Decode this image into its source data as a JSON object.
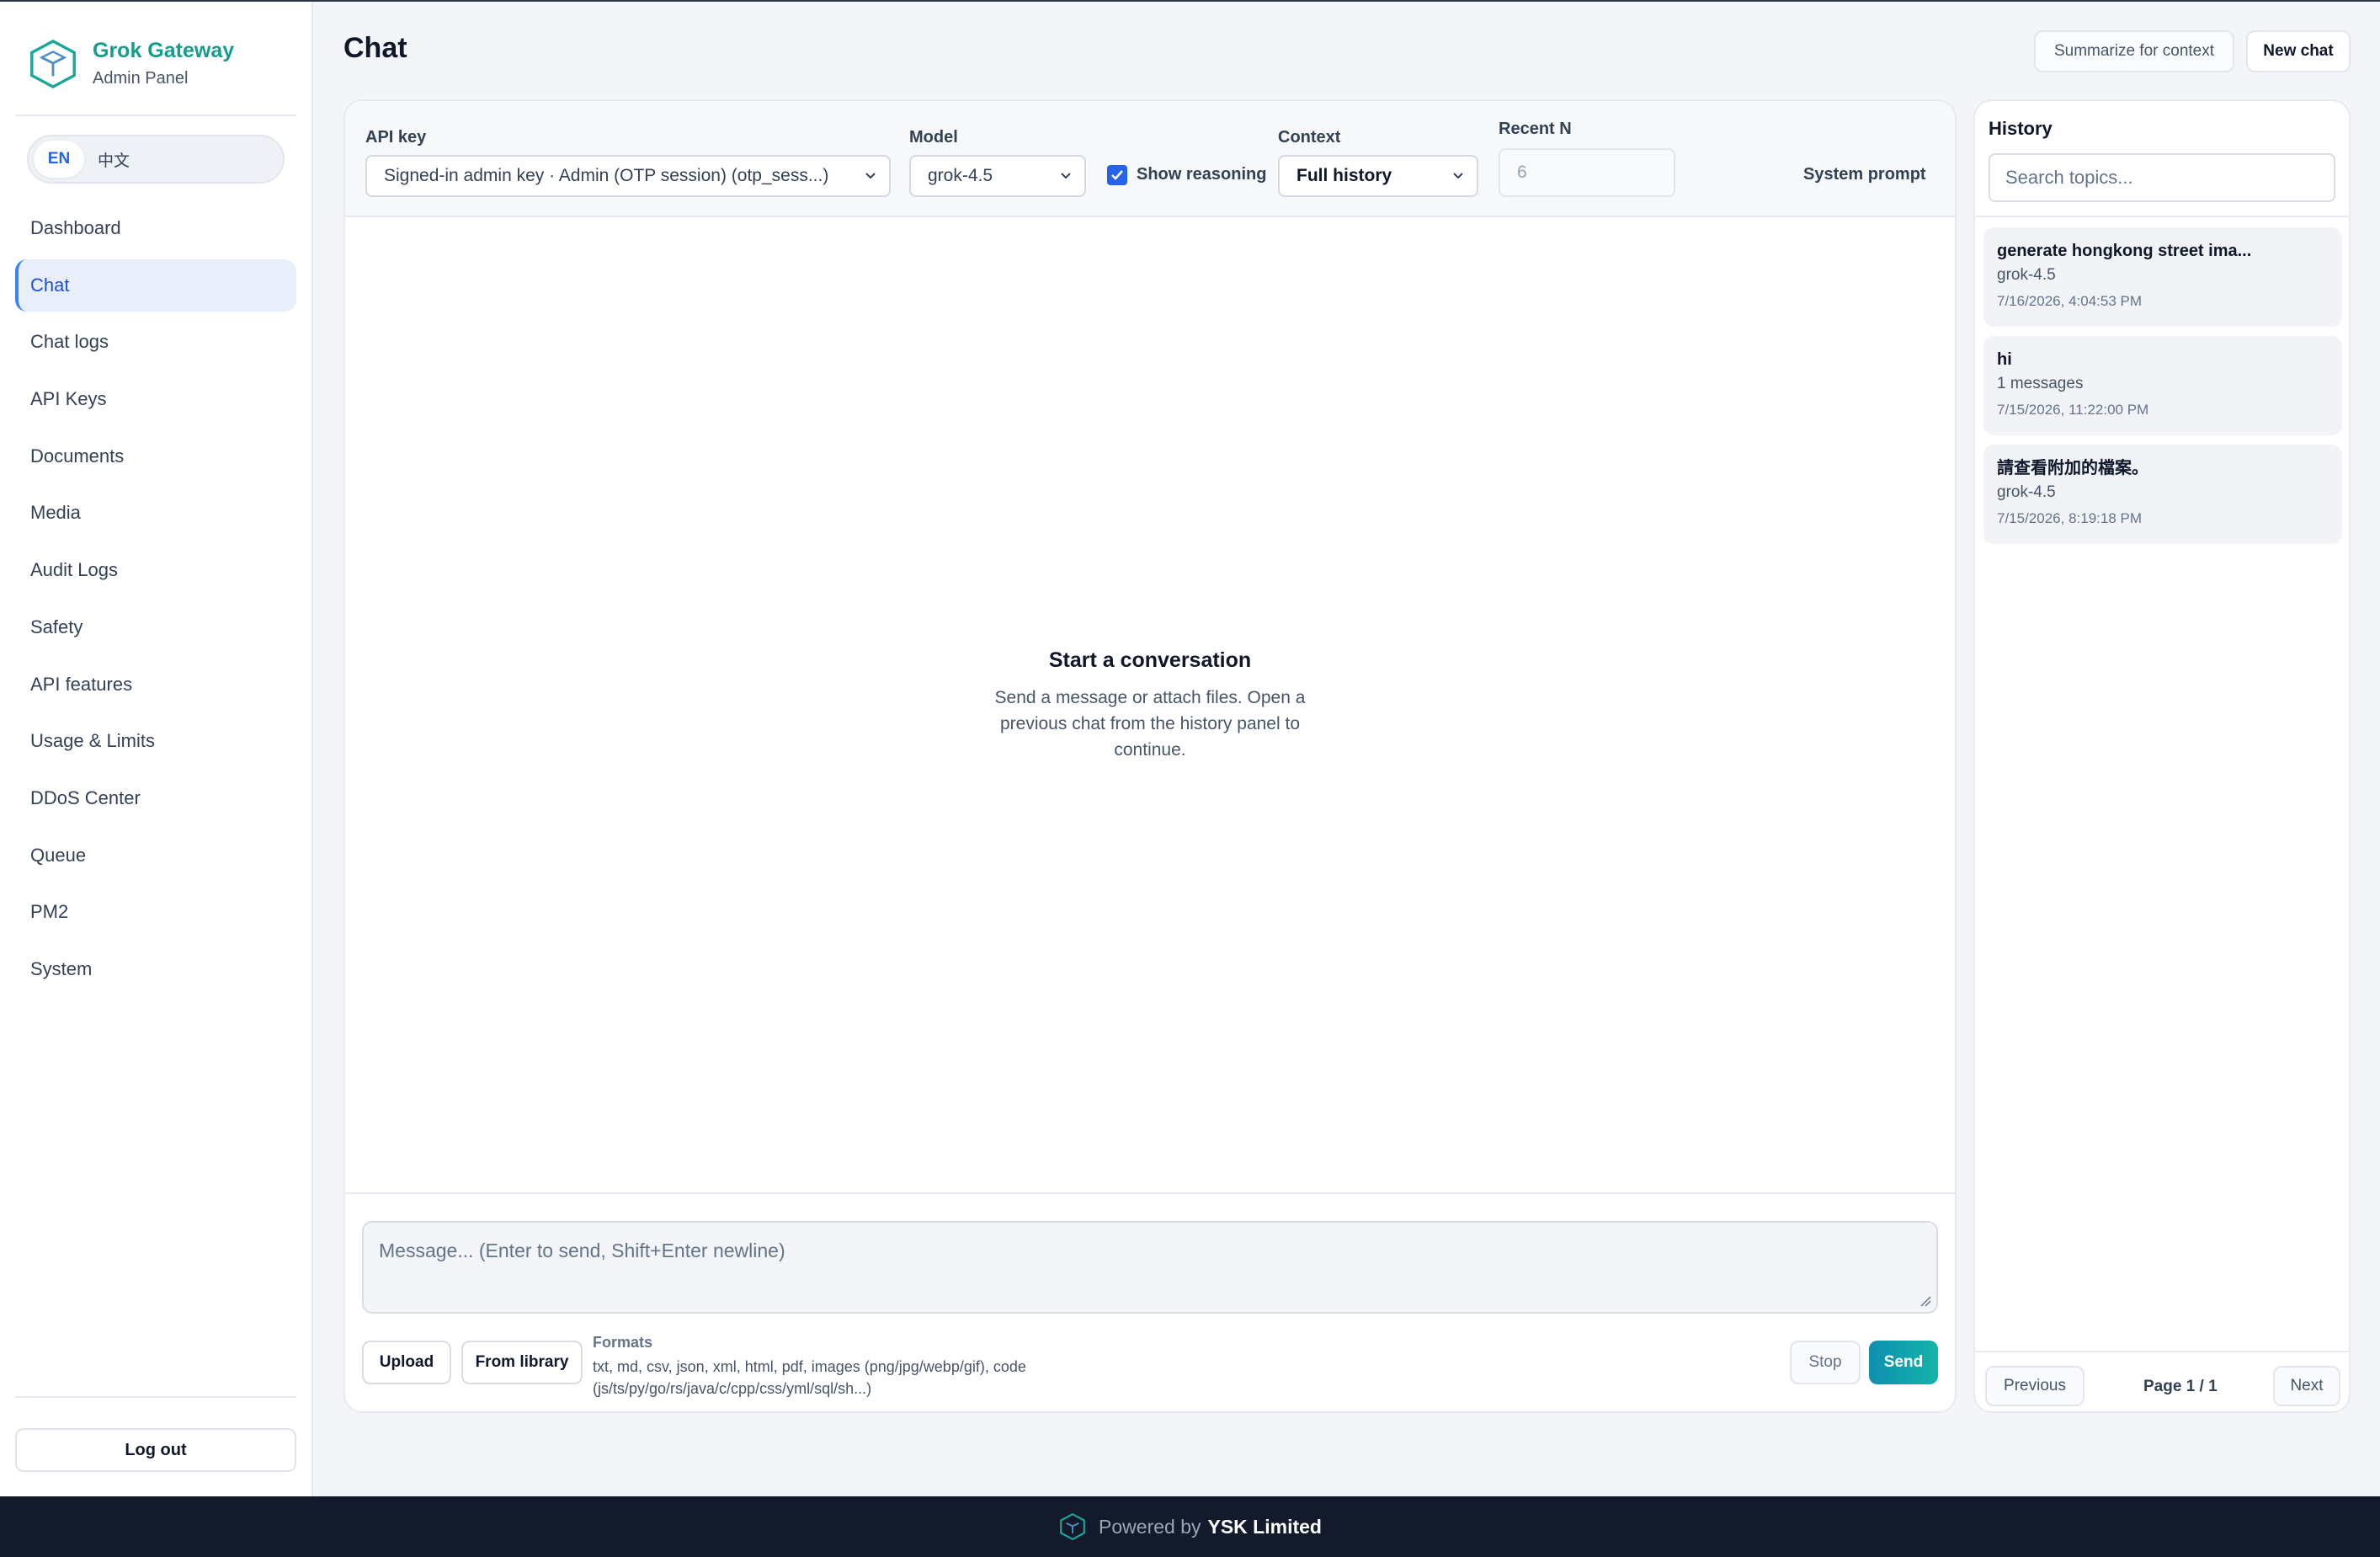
{
  "brand": {
    "title": "Grok Gateway",
    "subtitle": "Admin Panel"
  },
  "language": {
    "en": "EN",
    "zh": "中文",
    "active": "EN"
  },
  "sidebar": {
    "items": [
      {
        "label": "Dashboard",
        "active": false
      },
      {
        "label": "Chat",
        "active": true
      },
      {
        "label": "Chat logs",
        "active": false
      },
      {
        "label": "API Keys",
        "active": false
      },
      {
        "label": "Documents",
        "active": false
      },
      {
        "label": "Media",
        "active": false
      },
      {
        "label": "Audit Logs",
        "active": false
      },
      {
        "label": "Safety",
        "active": false
      },
      {
        "label": "API features",
        "active": false
      },
      {
        "label": "Usage & Limits",
        "active": false
      },
      {
        "label": "DDoS Center",
        "active": false
      },
      {
        "label": "Queue",
        "active": false
      },
      {
        "label": "PM2",
        "active": false
      },
      {
        "label": "System",
        "active": false
      }
    ],
    "logout_label": "Log out"
  },
  "header": {
    "title": "Chat",
    "summarize_label": "Summarize for context",
    "new_chat_label": "New chat"
  },
  "controls": {
    "api_key_label": "API key",
    "api_key_value": "Signed-in admin key · Admin (OTP session) (otp_sess...)",
    "model_label": "Model",
    "model_value": "grok-4.5",
    "show_reasoning_label": "Show reasoning",
    "show_reasoning_checked": true,
    "context_label": "Context",
    "context_value": "Full history",
    "recent_n_label": "Recent N",
    "recent_n_value": "6",
    "system_prompt_label": "System prompt"
  },
  "empty_state": {
    "title": "Start a conversation",
    "description": "Send a message or attach files. Open a previous chat from the history panel to continue."
  },
  "composer": {
    "placeholder": "Message... (Enter to send, Shift+Enter newline)",
    "upload_label": "Upload",
    "library_label": "From library",
    "formats_label": "Formats",
    "formats_text": "txt, md, csv, json, xml, html, pdf, images (png/jpg/webp/gif), code (js/ts/py/go/rs/java/c/cpp/css/yml/sql/sh...)",
    "stop_label": "Stop",
    "send_label": "Send"
  },
  "history": {
    "title": "History",
    "search_placeholder": "Search topics...",
    "items": [
      {
        "title": "generate hongkong street ima...",
        "meta": "grok-4.5",
        "date": "7/16/2026, 4:04:53 PM"
      },
      {
        "title": "hi",
        "meta": "1 messages",
        "date": "7/15/2026, 11:22:00 PM"
      },
      {
        "title": "請查看附加的檔案。",
        "meta": "grok-4.5",
        "date": "7/15/2026, 8:19:18 PM"
      }
    ],
    "prev_label": "Previous",
    "page_text": "Page 1 / 1",
    "next_label": "Next"
  },
  "footer": {
    "prefix": "Powered by",
    "company": "YSK Limited"
  },
  "colors": {
    "accent": "#2563eb",
    "brand": "#159c8c",
    "footer_bg": "#121a2b"
  }
}
